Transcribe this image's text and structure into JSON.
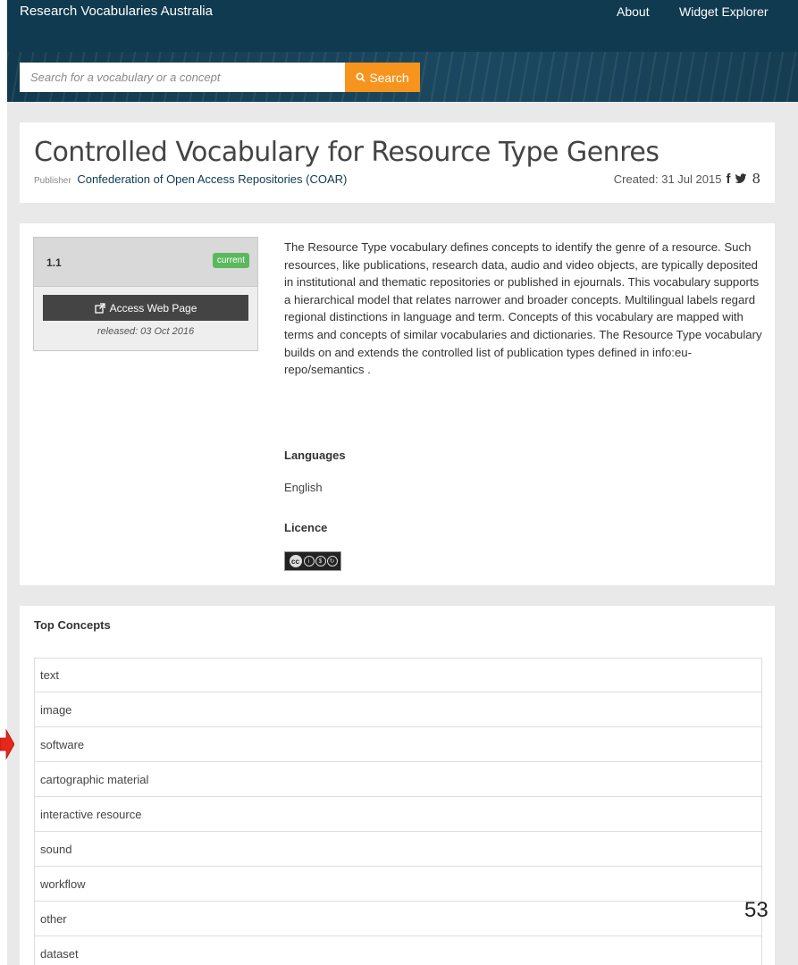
{
  "header": {
    "site_title": "Research Vocabularies Australia",
    "nav": [
      {
        "label": "About"
      },
      {
        "label": "Widget Explorer"
      }
    ]
  },
  "search": {
    "placeholder": "Search for a vocabulary or a concept",
    "value": "",
    "button_label": "Search",
    "button_icon": "search-icon"
  },
  "vocabulary": {
    "title": "Controlled Vocabulary for Resource Type Genres",
    "publisher_label": "Publisher",
    "publisher_name": "Confederation of Open Access Repositories (COAR)",
    "created": "Created: 31 Jul 2015",
    "social": [
      {
        "name": "facebook-icon",
        "glyph": "f"
      },
      {
        "name": "twitter-icon",
        "glyph": "✦"
      },
      {
        "name": "google-plus-icon",
        "glyph": "8"
      }
    ]
  },
  "version": {
    "number": "1.1",
    "status": "current",
    "access_label": "Access Web Page",
    "released": "released: 03 Oct 2016"
  },
  "description": "The Resource Type vocabulary defines concepts to identify the genre of a resource. Such resources, like publications, research data, audio and video objects, are typically deposited in institutional and thematic repositories or published in ejournals. This vocabulary supports a hierarchical model that relates narrower and broader concepts. Multilingual labels regard regional distinctions in language and term. Concepts of this vocabulary are mapped with terms and concepts of similar vocabularies and dictionaries. The Resource Type vocabulary builds on and extends the controlled list of publication types defined in info:eu-repo/semantics .",
  "languages": {
    "label": "Languages",
    "value": "English"
  },
  "licence": {
    "label": "Licence",
    "badge": "cc-by-nc-sa-badge"
  },
  "top_concepts": {
    "label": "Top Concepts",
    "items": [
      "text",
      "image",
      "software",
      "cartographic material",
      "interactive resource",
      "sound",
      "workflow",
      "other",
      "dataset"
    ]
  },
  "annotation": {
    "slide_number": "53",
    "arrow_color": "#e8271c"
  },
  "colors": {
    "header_bg": "#0f3a4f",
    "search_button": "#f7941e",
    "badge_green": "#5cb85c",
    "page_bg": "#e9e9e9"
  }
}
